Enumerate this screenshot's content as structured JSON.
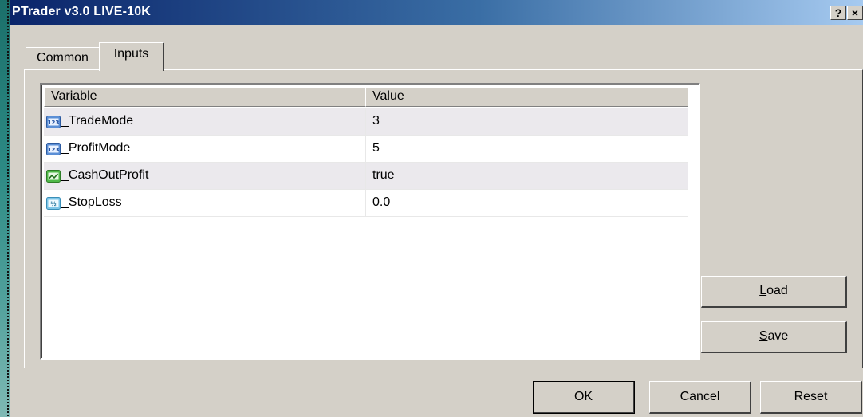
{
  "window": {
    "title": "PTrader v3.0 LIVE-10K",
    "help_label": "?",
    "close_label": "×"
  },
  "tabs": [
    {
      "label": "Common",
      "selected": false
    },
    {
      "label": "Inputs",
      "selected": true
    }
  ],
  "table": {
    "columns": [
      "Variable",
      "Value"
    ],
    "rows": [
      {
        "icon": "integer-123-icon",
        "variable": "_TradeMode",
        "value": "3"
      },
      {
        "icon": "integer-123-icon",
        "variable": "_ProfitMode",
        "value": "5"
      },
      {
        "icon": "boolean-chart-icon",
        "variable": "_CashOutProfit",
        "value": "true"
      },
      {
        "icon": "double-half-icon",
        "variable": "_StopLoss",
        "value": "0.0"
      }
    ]
  },
  "side_buttons": {
    "load_first": "L",
    "load_rest": "oad",
    "save_first": "S",
    "save_rest": "ave"
  },
  "footer_buttons": {
    "ok": "OK",
    "cancel": "Cancel",
    "reset": "Reset"
  },
  "colors": {
    "title_start": "#0a246a",
    "title_end": "#a6caf0",
    "face": "#d4d0c8",
    "row_alt": "#ebe9ed"
  }
}
